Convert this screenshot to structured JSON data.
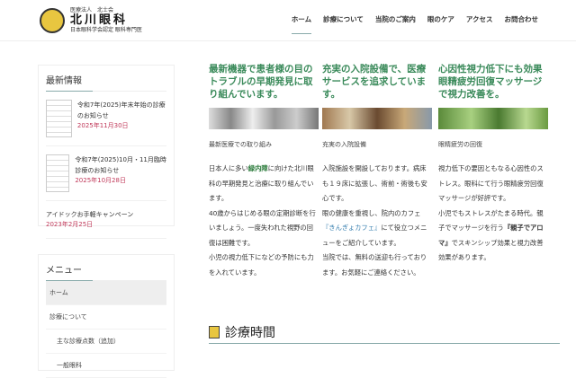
{
  "header": {
    "logo_small": "医療法人　北士会",
    "logo_name": "北川眼科",
    "logo_sub": "日本眼科学会認定 眼科専門医"
  },
  "nav": [
    "ホーム",
    "診療について",
    "当院のご案内",
    "眼のケア",
    "アクセス",
    "お問合わせ"
  ],
  "news": {
    "title": "最新情報",
    "items": [
      {
        "title": "令和7年(2025)年末年始の診療のお知らせ",
        "date": "2025年11月30日"
      },
      {
        "title": "令和7年(2025)10月・11月臨時診療のお知らせ",
        "date": "2025年10月28日"
      },
      {
        "title": "アイドックお手軽キャンペーン",
        "date": "2023年2月25日"
      }
    ]
  },
  "menu": {
    "title": "メニュー",
    "items": [
      "ホーム",
      "診療について",
      "主な診療点数（追加）",
      "一般眼科"
    ]
  },
  "columns": [
    {
      "headline": "最新機器で患者様の目のトラブルの早期発見に取り組んでいます。",
      "caption": "最新医療での取り組み",
      "p1": "日本人に多い",
      "hl": "緑内障",
      "p2": "に向けた北川眼科の早期発見と治療に取り組んでいます。",
      "p3": "40歳からはじめる眼の定期診断を行いましょう。一度失われた視野の回復は困難です。",
      "p4": "小児の視力低下になどの予防にも力を入れています。"
    },
    {
      "headline": "充実の入院設備で、医療サービスを追求しています。",
      "caption": "充実の入院設備",
      "p1": "入院施設を開設しております。病床も１９床に拡張し、術前・術後も安心です。",
      "p2": "眼の健康を重視し、院内のカフェ",
      "link": "『きんぎょカフェ』",
      "p3": "にて役立つメニューをご紹介しています。",
      "p4": "当院では、無料の送迎も行っております。お気軽にご連絡ください。"
    },
    {
      "headline": "心因性視力低下にも効果眼精疲労回復マッサージで視力改善を。",
      "caption": "眼精疲労の回復",
      "p1": "視力低下の要因ともなる心因性のストレス。眼科にて行う眼精疲労回復マッサージが好評です。",
      "p2": "小児でもストレスがたまる時代。親子でマッサージを行う",
      "bold": "『親子でアロマ』",
      "p3": "でスキンシップ効果と視力改善効果があります。"
    }
  ],
  "schedule": {
    "title": "診療時間"
  }
}
